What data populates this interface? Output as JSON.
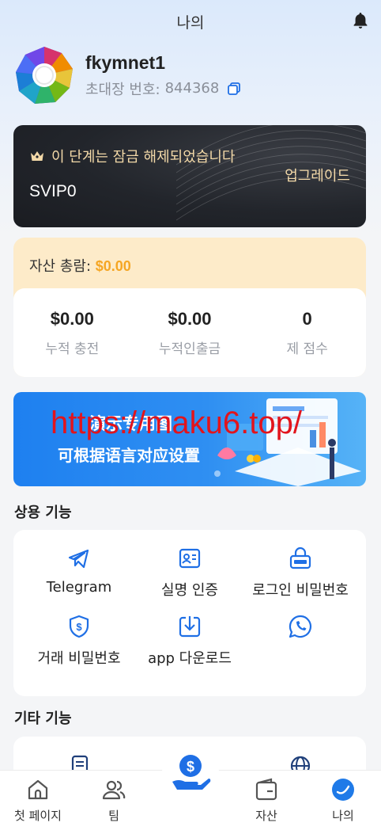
{
  "header": {
    "title": "나의"
  },
  "profile": {
    "username": "fkymnet1",
    "invite_label": "초대장 번호:",
    "invite_code": "844368"
  },
  "vip": {
    "status_text": "이 단계는 잠금 해제되었습니다",
    "upgrade_label": "업그레이드",
    "level": "SVIP0"
  },
  "assets": {
    "total_label": "자산 총람:",
    "total_value": "$0.00",
    "stats": [
      {
        "value": "$0.00",
        "label": "누적 충전"
      },
      {
        "value": "$0.00",
        "label": "누적인출금"
      },
      {
        "value": "0",
        "label": "제 점수"
      }
    ]
  },
  "banner": {
    "line1": "演示专用图",
    "line2": "可根据语言对应设置"
  },
  "watermark": "https://maku6.top/",
  "common_functions": {
    "title": "상용 기능",
    "items": [
      {
        "label": "Telegram",
        "icon": "telegram-icon"
      },
      {
        "label": "실명 인증",
        "icon": "id-card-icon"
      },
      {
        "label": "로그인 비밀번호",
        "icon": "lock-icon"
      },
      {
        "label": "거래 비밀번호",
        "icon": "dollar-shield-icon"
      },
      {
        "label": "app 다운로드",
        "icon": "download-icon"
      },
      {
        "label": "",
        "icon": "whatsapp-icon"
      }
    ]
  },
  "other_functions": {
    "title": "기타 기능"
  },
  "tabbar": {
    "items": [
      {
        "label": "첫 페이지",
        "icon": "home-icon"
      },
      {
        "label": "팀",
        "icon": "team-icon"
      },
      {
        "label": "",
        "icon": "money-hand-icon"
      },
      {
        "label": "자산",
        "icon": "wallet-icon"
      },
      {
        "label": "나의",
        "icon": "profile-icon"
      }
    ]
  },
  "colors": {
    "accent": "#1f6fe5",
    "gold": "#f5a623",
    "vip_gold": "#f3d9a8"
  }
}
